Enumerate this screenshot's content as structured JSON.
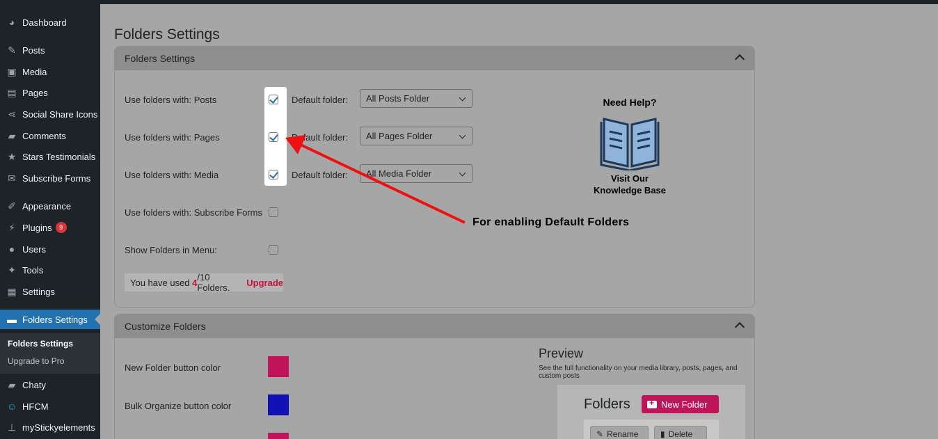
{
  "sidebar": {
    "items": [
      {
        "label": "Dashboard",
        "icon": "dashboard-icon"
      },
      {
        "label": "Posts",
        "icon": "pin-icon"
      },
      {
        "label": "Media",
        "icon": "media-icon"
      },
      {
        "label": "Pages",
        "icon": "pages-icon"
      },
      {
        "label": "Social Share Icons",
        "icon": "share-icon"
      },
      {
        "label": "Comments",
        "icon": "comment-icon"
      },
      {
        "label": "Stars Testimonials",
        "icon": "star-icon"
      },
      {
        "label": "Subscribe Forms",
        "icon": "mail-icon"
      },
      {
        "label": "Appearance",
        "icon": "brush-icon"
      },
      {
        "label": "Plugins",
        "icon": "plugin-icon",
        "badge": "9"
      },
      {
        "label": "Users",
        "icon": "user-icon"
      },
      {
        "label": "Tools",
        "icon": "wrench-icon"
      },
      {
        "label": "Settings",
        "icon": "settings-icon"
      },
      {
        "label": "Folders Settings",
        "icon": "folder-icon"
      },
      {
        "label": "Chaty",
        "icon": "chat-icon"
      },
      {
        "label": "HFCM",
        "icon": "robot-icon"
      },
      {
        "label": "myStickyelements",
        "icon": "pin-icon"
      }
    ],
    "submenu": {
      "current": "Folders Settings",
      "upgrade": "Upgrade to Pro"
    }
  },
  "page": {
    "title": "Folders Settings"
  },
  "settings_panel": {
    "title": "Folders Settings",
    "rows": [
      {
        "label": "Use folders with: Posts",
        "checked": true,
        "default_label": "Default folder:",
        "select": "All Posts Folder"
      },
      {
        "label": "Use folders with: Pages",
        "checked": true,
        "default_label": "Default folder:",
        "select": "All Pages Folder"
      },
      {
        "label": "Use folders with: Media",
        "checked": true,
        "default_label": "Default folder:",
        "select": "All Media Folder"
      },
      {
        "label": "Use folders with: Subscribe Forms",
        "checked": false
      },
      {
        "label": "Show Folders in Menu:",
        "checked": false
      }
    ],
    "usage": {
      "prefix": "You have used ",
      "used": "4",
      "suffix": "/10 Folders.",
      "upgrade": "Upgrade"
    },
    "help": {
      "title": "Need Help?",
      "line1": "Visit Our",
      "line2": "Knowledge Base"
    },
    "annotation": "For enabling Default Folders"
  },
  "customize_panel": {
    "title": "Customize Folders",
    "rows": [
      {
        "label": "New Folder button color",
        "color": "#c0145a"
      },
      {
        "label": "Bulk Organize button color",
        "color": "#1010b4"
      }
    ],
    "extra_color": "#c0145a",
    "preview": {
      "title": "Preview",
      "description": "See the full functionality on your media library, posts, pages, and custom posts",
      "folders_label": "Folders",
      "new_folder": "New Folder",
      "rename": "Rename",
      "delete": "Delete"
    }
  },
  "colors": {
    "accent": "#2271b1",
    "brand_pink": "#c0145a",
    "arrow": "#ee1111"
  }
}
